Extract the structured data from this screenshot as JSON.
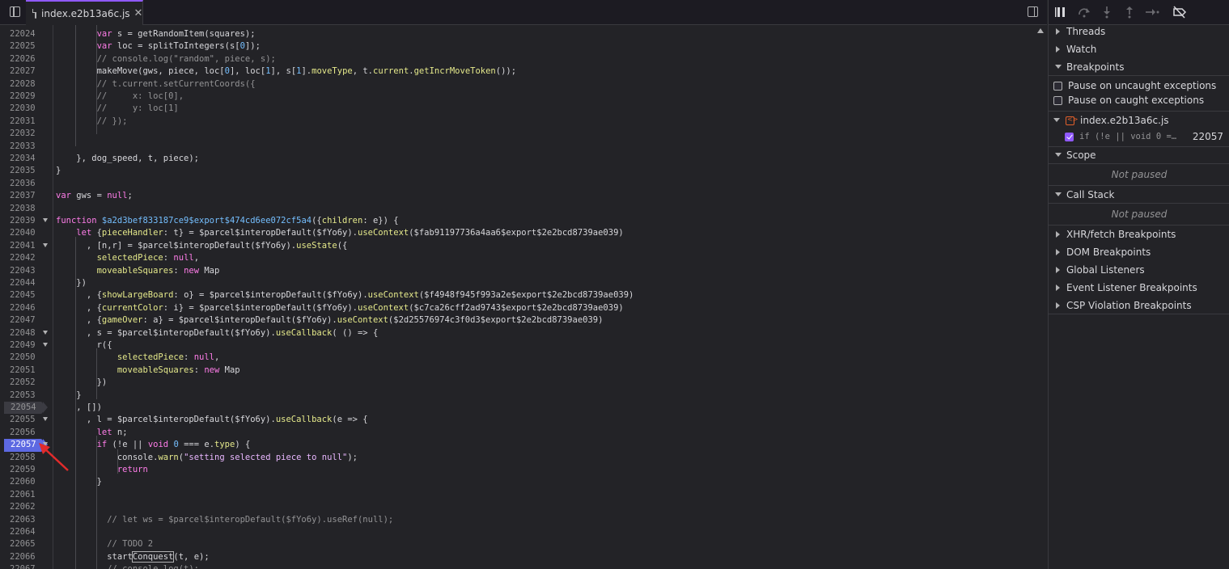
{
  "tab": {
    "filename": "index.e2b13a6c.js",
    "close_glyph": "✕"
  },
  "gutter": {
    "lines": [
      {
        "n": "22024",
        "fold": false
      },
      {
        "n": "22025",
        "fold": false
      },
      {
        "n": "22026",
        "fold": false
      },
      {
        "n": "22027",
        "fold": false
      },
      {
        "n": "22028",
        "fold": false
      },
      {
        "n": "22029",
        "fold": false
      },
      {
        "n": "22030",
        "fold": false
      },
      {
        "n": "22031",
        "fold": false
      },
      {
        "n": "22032",
        "fold": false
      },
      {
        "n": "22033",
        "fold": false
      },
      {
        "n": "22034",
        "fold": false
      },
      {
        "n": "22035",
        "fold": false
      },
      {
        "n": "22036",
        "fold": false
      },
      {
        "n": "22037",
        "fold": false
      },
      {
        "n": "22038",
        "fold": false
      },
      {
        "n": "22039",
        "fold": true
      },
      {
        "n": "22040",
        "fold": false
      },
      {
        "n": "22041",
        "fold": true
      },
      {
        "n": "22042",
        "fold": false
      },
      {
        "n": "22043",
        "fold": false
      },
      {
        "n": "22044",
        "fold": false
      },
      {
        "n": "22045",
        "fold": false
      },
      {
        "n": "22046",
        "fold": false
      },
      {
        "n": "22047",
        "fold": false
      },
      {
        "n": "22048",
        "fold": true
      },
      {
        "n": "22049",
        "fold": true
      },
      {
        "n": "22050",
        "fold": false
      },
      {
        "n": "22051",
        "fold": false
      },
      {
        "n": "22052",
        "fold": false
      },
      {
        "n": "22053",
        "fold": false
      },
      {
        "n": "22054",
        "fold": false,
        "hint": true
      },
      {
        "n": "22055",
        "fold": true
      },
      {
        "n": "22056",
        "fold": false
      },
      {
        "n": "22057",
        "fold": true,
        "bp": true
      },
      {
        "n": "22058",
        "fold": false
      },
      {
        "n": "22059",
        "fold": false
      },
      {
        "n": "22060",
        "fold": false
      },
      {
        "n": "22061",
        "fold": false
      },
      {
        "n": "22062",
        "fold": false
      },
      {
        "n": "22063",
        "fold": false
      },
      {
        "n": "22064",
        "fold": false
      },
      {
        "n": "22065",
        "fold": false
      },
      {
        "n": "22066",
        "fold": false
      },
      {
        "n": "22067",
        "fold": false
      }
    ]
  },
  "code": [
    [
      {
        "t": "        "
      },
      {
        "t": "var",
        "c": "k"
      },
      {
        "t": " s = getRandomItem(squares);"
      }
    ],
    [
      {
        "t": "        "
      },
      {
        "t": "var",
        "c": "k"
      },
      {
        "t": " loc = splitToIntegers(s["
      },
      {
        "t": "0",
        "c": "p"
      },
      {
        "t": "]);"
      }
    ],
    [
      {
        "t": "        "
      },
      {
        "t": "// console.log(\"random\", piece, s);",
        "c": "c"
      }
    ],
    [
      {
        "t": "        makeMove(gws, piece, loc["
      },
      {
        "t": "0",
        "c": "p"
      },
      {
        "t": "], loc["
      },
      {
        "t": "1",
        "c": "p"
      },
      {
        "t": "], s["
      },
      {
        "t": "1",
        "c": "p"
      },
      {
        "t": "]."
      },
      {
        "t": "moveType",
        "c": "m"
      },
      {
        "t": ", t."
      },
      {
        "t": "current",
        "c": "m"
      },
      {
        "t": "."
      },
      {
        "t": "getIncrMoveToken",
        "c": "m"
      },
      {
        "t": "());"
      }
    ],
    [
      {
        "t": "        "
      },
      {
        "t": "// t.current.setCurrentCoords({",
        "c": "c"
      }
    ],
    [
      {
        "t": "        "
      },
      {
        "t": "//     x: loc[0],",
        "c": "c"
      }
    ],
    [
      {
        "t": "        "
      },
      {
        "t": "//     y: loc[1]",
        "c": "c"
      }
    ],
    [
      {
        "t": "        "
      },
      {
        "t": "// });",
        "c": "c"
      }
    ],
    [
      {
        "t": ""
      }
    ],
    [
      {
        "t": ""
      }
    ],
    [
      {
        "t": "    }, dog_speed, t, piece);"
      }
    ],
    [
      {
        "t": "}"
      }
    ],
    [
      {
        "t": ""
      }
    ],
    [
      {
        "t": "var",
        "c": "k"
      },
      {
        "t": " gws = "
      },
      {
        "t": "null",
        "c": "k"
      },
      {
        "t": ";"
      }
    ],
    [
      {
        "t": ""
      }
    ],
    [
      {
        "t": "function",
        "c": "k"
      },
      {
        "t": " "
      },
      {
        "t": "$a2d3bef833187ce9$export$474cd6ee072cf5a4",
        "c": "p"
      },
      {
        "t": "({"
      },
      {
        "t": "children",
        "c": "m"
      },
      {
        "t": ": e}) {"
      }
    ],
    [
      {
        "t": "    "
      },
      {
        "t": "let",
        "c": "k"
      },
      {
        "t": " {"
      },
      {
        "t": "pieceHandler",
        "c": "m"
      },
      {
        "t": ": t} = $parcel$interopDefault($fYo6y)."
      },
      {
        "t": "useContext",
        "c": "m"
      },
      {
        "t": "($fab91197736a4aa6$export$2e2bcd8739ae039)"
      }
    ],
    [
      {
        "t": "      , [n,r] = $parcel$interopDefault($fYo6y)."
      },
      {
        "t": "useState",
        "c": "m"
      },
      {
        "t": "({"
      }
    ],
    [
      {
        "t": "        "
      },
      {
        "t": "selectedPiece",
        "c": "m"
      },
      {
        "t": ": "
      },
      {
        "t": "null",
        "c": "k"
      },
      {
        "t": ","
      }
    ],
    [
      {
        "t": "        "
      },
      {
        "t": "moveableSquares",
        "c": "m"
      },
      {
        "t": ": "
      },
      {
        "t": "new",
        "c": "k"
      },
      {
        "t": " Map"
      }
    ],
    [
      {
        "t": "    })"
      }
    ],
    [
      {
        "t": "      , {"
      },
      {
        "t": "showLargeBoard",
        "c": "m"
      },
      {
        "t": ": o} = $parcel$interopDefault($fYo6y)."
      },
      {
        "t": "useContext",
        "c": "m"
      },
      {
        "t": "($f4948f945f993a2e$export$2e2bcd8739ae039)"
      }
    ],
    [
      {
        "t": "      , {"
      },
      {
        "t": "currentColor",
        "c": "m"
      },
      {
        "t": ": i} = $parcel$interopDefault($fYo6y)."
      },
      {
        "t": "useContext",
        "c": "m"
      },
      {
        "t": "($c7ca26cff2ad9743$export$2e2bcd8739ae039)"
      }
    ],
    [
      {
        "t": "      , {"
      },
      {
        "t": "gameOver",
        "c": "m"
      },
      {
        "t": ": a} = $parcel$interopDefault($fYo6y)."
      },
      {
        "t": "useContext",
        "c": "m"
      },
      {
        "t": "($2d25576974c3f0d3$export$2e2bcd8739ae039)"
      }
    ],
    [
      {
        "t": "      , s = $parcel$interopDefault($fYo6y)."
      },
      {
        "t": "useCallback",
        "c": "m"
      },
      {
        "t": "( () => {"
      }
    ],
    [
      {
        "t": "        r({"
      }
    ],
    [
      {
        "t": "            "
      },
      {
        "t": "selectedPiece",
        "c": "m"
      },
      {
        "t": ": "
      },
      {
        "t": "null",
        "c": "k"
      },
      {
        "t": ","
      }
    ],
    [
      {
        "t": "            "
      },
      {
        "t": "moveableSquares",
        "c": "m"
      },
      {
        "t": ": "
      },
      {
        "t": "new",
        "c": "k"
      },
      {
        "t": " Map"
      }
    ],
    [
      {
        "t": "        })"
      }
    ],
    [
      {
        "t": "    }"
      }
    ],
    [
      {
        "t": "    , [])"
      }
    ],
    [
      {
        "t": "      , l = $parcel$interopDefault($fYo6y)."
      },
      {
        "t": "useCallback",
        "c": "m"
      },
      {
        "t": "(e => {"
      }
    ],
    [
      {
        "t": "        "
      },
      {
        "t": "let",
        "c": "k"
      },
      {
        "t": " n;"
      }
    ],
    [
      {
        "t": "        "
      },
      {
        "t": "if",
        "c": "k"
      },
      {
        "t": " (!e || "
      },
      {
        "t": "void",
        "c": "k"
      },
      {
        "t": " "
      },
      {
        "t": "0",
        "c": "p"
      },
      {
        "t": " === e."
      },
      {
        "t": "type",
        "c": "m"
      },
      {
        "t": ") {"
      }
    ],
    [
      {
        "t": "            console."
      },
      {
        "t": "warn",
        "c": "m"
      },
      {
        "t": "("
      },
      {
        "t": "\"setting selected piece to null\"",
        "c": "str"
      },
      {
        "t": ");"
      }
    ],
    [
      {
        "t": "            "
      },
      {
        "t": "return",
        "c": "k"
      }
    ],
    [
      {
        "t": "        }"
      }
    ],
    [
      {
        "t": ""
      }
    ],
    [
      {
        "t": ""
      }
    ],
    [
      {
        "t": "          "
      },
      {
        "t": "// let ws = $parcel$interopDefault($fYo6y).useRef(null);",
        "c": "c"
      }
    ],
    [
      {
        "t": ""
      }
    ],
    [
      {
        "t": "          "
      },
      {
        "t": "// TODO 2",
        "c": "c"
      }
    ],
    [
      {
        "t": "          start"
      },
      {
        "t": "Conquest",
        "c": "boxed"
      },
      {
        "t": "(t, e);"
      }
    ],
    [
      {
        "t": "          "
      },
      {
        "t": "// console.log(t);",
        "c": "c"
      }
    ]
  ],
  "sidebar": {
    "threads": "Threads",
    "watch": "Watch",
    "breakpoints": "Breakpoints",
    "pause_uncaught": "Pause on uncaught exceptions",
    "pause_caught": "Pause on caught exceptions",
    "bp_file": "index.e2b13a6c.js",
    "bp_code": "if (!e || void 0 =…",
    "bp_line": "22057",
    "scope": "Scope",
    "scope_status": "Not paused",
    "call_stack": "Call Stack",
    "call_stack_status": "Not paused",
    "xhr": "XHR/fetch Breakpoints",
    "dom": "DOM Breakpoints",
    "global": "Global Listeners",
    "event": "Event Listener Breakpoints",
    "csp": "CSP Violation Breakpoints"
  },
  "toolbar_icons": [
    "pause-icon",
    "step-over-icon",
    "step-in-icon",
    "step-out-icon",
    "run-to-icon",
    "deactivate-breakpoints-icon"
  ],
  "colors": {
    "accent": "#9059ff",
    "breakpoint": "#5d69e2",
    "annotation": "#e22b2b"
  }
}
